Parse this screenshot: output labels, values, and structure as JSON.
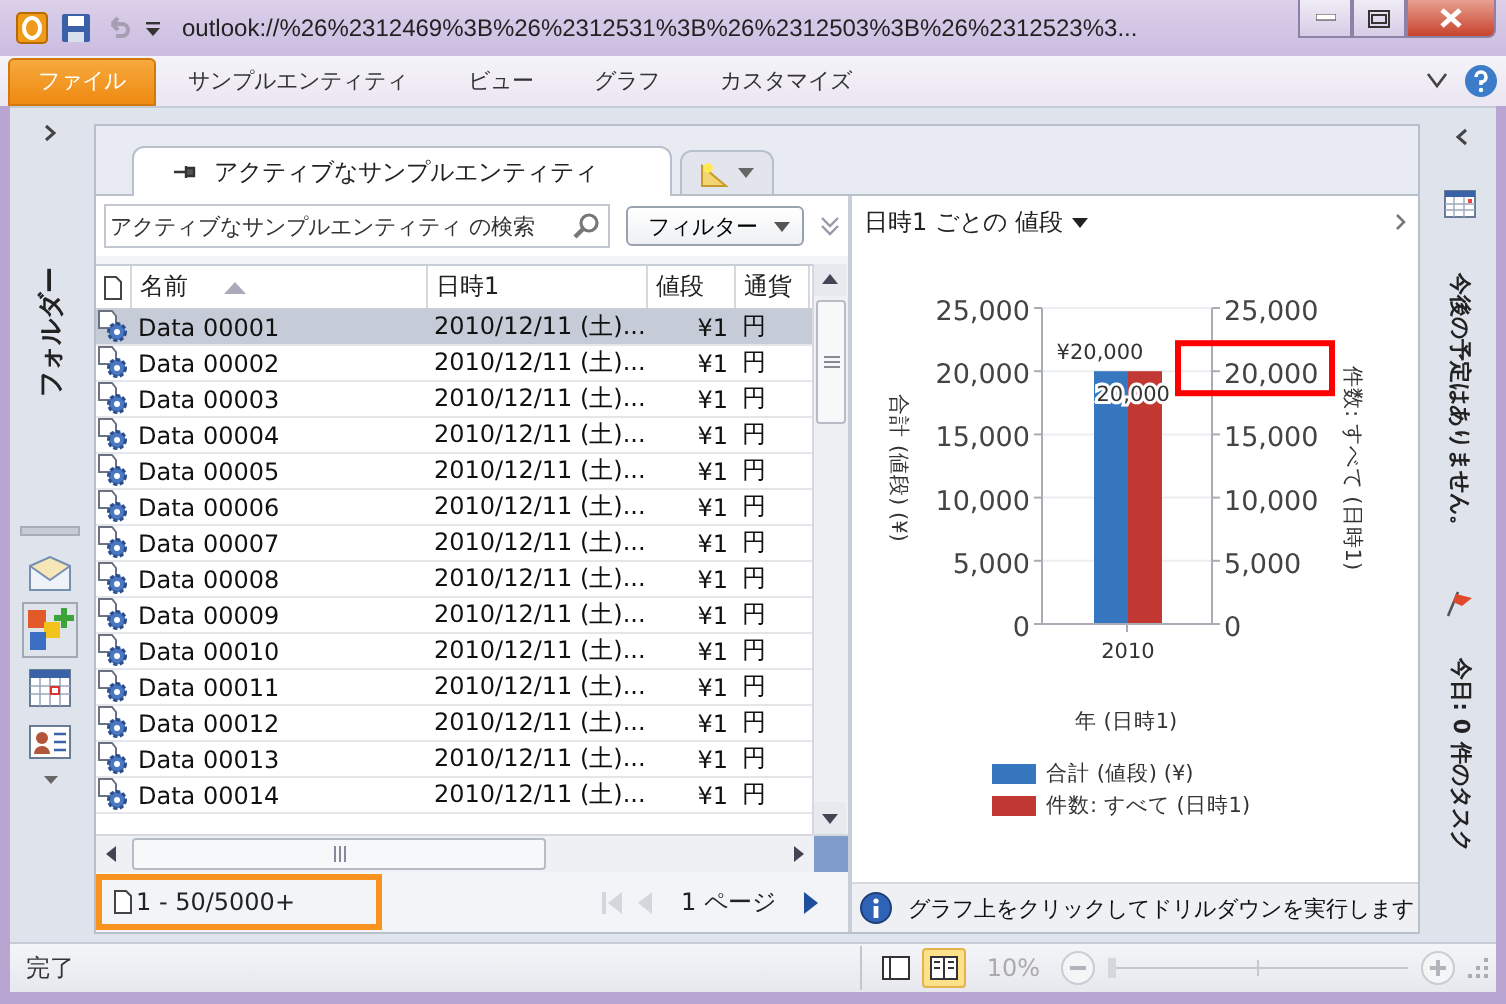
{
  "window": {
    "title": "outlook://%26%2312469%3B%26%2312531%3B%26%2312503%3B%26%2312523%3..."
  },
  "ribbon": {
    "tabs": [
      {
        "label": "ファイル",
        "selected": true
      },
      {
        "label": "サンプルエンティティ",
        "selected": false
      },
      {
        "label": "ビュー",
        "selected": false
      },
      {
        "label": "グラフ",
        "selected": false
      },
      {
        "label": "カスタマイズ",
        "selected": false
      }
    ]
  },
  "nav_pane": {
    "label": "フォルダー"
  },
  "tab_strip": {
    "tabs": [
      {
        "label": "アクティブなサンプルエンティティ",
        "selected": true
      }
    ]
  },
  "list": {
    "search": {
      "placeholder": "アクティブなサンプルエンティティ の検索"
    },
    "filter_button": "フィルター",
    "columns": [
      {
        "label": "名前",
        "sorted": true
      },
      {
        "label": "日時1",
        "sorted": false
      },
      {
        "label": "値段",
        "sorted": false
      },
      {
        "label": "通貨",
        "sorted": false
      }
    ],
    "rows": [
      {
        "name": "Data 00001",
        "date": "2010/12/11 (土)...",
        "price": "¥1",
        "currency": "円",
        "selected": true
      },
      {
        "name": "Data 00002",
        "date": "2010/12/11 (土)...",
        "price": "¥1",
        "currency": "円",
        "selected": false
      },
      {
        "name": "Data 00003",
        "date": "2010/12/11 (土)...",
        "price": "¥1",
        "currency": "円",
        "selected": false
      },
      {
        "name": "Data 00004",
        "date": "2010/12/11 (土)...",
        "price": "¥1",
        "currency": "円",
        "selected": false
      },
      {
        "name": "Data 00005",
        "date": "2010/12/11 (土)...",
        "price": "¥1",
        "currency": "円",
        "selected": false
      },
      {
        "name": "Data 00006",
        "date": "2010/12/11 (土)...",
        "price": "¥1",
        "currency": "円",
        "selected": false
      },
      {
        "name": "Data 00007",
        "date": "2010/12/11 (土)...",
        "price": "¥1",
        "currency": "円",
        "selected": false
      },
      {
        "name": "Data 00008",
        "date": "2010/12/11 (土)...",
        "price": "¥1",
        "currency": "円",
        "selected": false
      },
      {
        "name": "Data 00009",
        "date": "2010/12/11 (土)...",
        "price": "¥1",
        "currency": "円",
        "selected": false
      },
      {
        "name": "Data 00010",
        "date": "2010/12/11 (土)...",
        "price": "¥1",
        "currency": "円",
        "selected": false
      },
      {
        "name": "Data 00011",
        "date": "2010/12/11 (土)...",
        "price": "¥1",
        "currency": "円",
        "selected": false
      },
      {
        "name": "Data 00012",
        "date": "2010/12/11 (土)...",
        "price": "¥1",
        "currency": "円",
        "selected": false
      },
      {
        "name": "Data 00013",
        "date": "2010/12/11 (土)...",
        "price": "¥1",
        "currency": "円",
        "selected": false
      },
      {
        "name": "Data 00014",
        "date": "2010/12/11 (土)...",
        "price": "¥1",
        "currency": "円",
        "selected": false
      }
    ],
    "count": {
      "text": "1 - 50/5000+",
      "color": "#f7931e"
    },
    "page": "1 ページ"
  },
  "chart_panel": {
    "title": "日時1 ごとの 値段",
    "highlight_box": {
      "color": "#ff0000"
    },
    "chart_data": {
      "type": "bar",
      "grid": true,
      "legend": "bottom",
      "xlabel": "年 (日時1)",
      "ylabel": "合計 (値段) (¥)",
      "y2label": "件数: すべて (日時1)",
      "categories": [
        "2010"
      ],
      "series": [
        {
          "name": "合計 (値段) (¥)",
          "color": "#3677c0",
          "values": [
            20000
          ]
        },
        {
          "name": "件数: すべて (日時1)",
          "color": "#c23832",
          "values": [
            20000
          ]
        }
      ],
      "ylim": [
        0,
        25000
      ],
      "y2lim": [
        0,
        25000
      ],
      "yticks": [
        {
          "value": 0,
          "label": "0"
        },
        {
          "value": 5000,
          "label": "5,000"
        },
        {
          "value": 10000,
          "label": "10,000"
        },
        {
          "value": 15000,
          "label": "15,000"
        },
        {
          "value": 20000,
          "label": "20,000"
        },
        {
          "value": 25000,
          "label": "25,000"
        }
      ],
      "y2ticks": [
        {
          "value": 0,
          "label": "0"
        },
        {
          "value": 5000,
          "label": "5,000"
        },
        {
          "value": 10000,
          "label": "10,000"
        },
        {
          "value": 15000,
          "label": "15,000"
        },
        {
          "value": 20000,
          "label": "20,000"
        },
        {
          "value": 25000,
          "label": "25,000"
        }
      ],
      "value_labels": [
        "¥20,000",
        "20,000"
      ]
    },
    "info": "グラフ上をクリックしてドリルダウンを実行します"
  },
  "todo_bar": {
    "appointments": "今後の予定はありません。",
    "tasks": "今日: 0 件のタスク"
  },
  "status_bar": {
    "status": "完了",
    "zoom": "10%",
    "zoom_slider": {
      "level": 0
    }
  }
}
